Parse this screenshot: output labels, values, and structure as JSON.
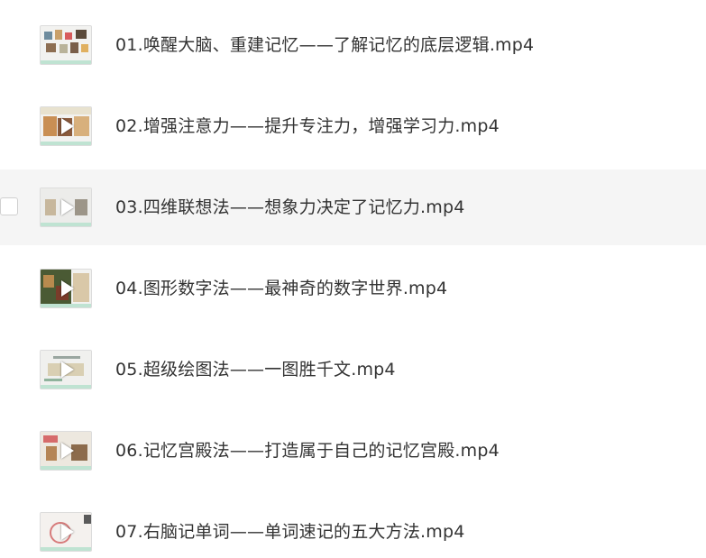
{
  "files": [
    {
      "name": "01.唤醒大脑、重建记忆——了解记忆的底层逻辑.mp4",
      "thumbnail": "video-thumbnail-icon",
      "hovered": false
    },
    {
      "name": "02.增强注意力——提升专注力，增强学习力.mp4",
      "thumbnail": "video-thumbnail-icon",
      "hovered": false
    },
    {
      "name": "03.四维联想法——想象力决定了记忆力.mp4",
      "thumbnail": "video-thumbnail-icon",
      "hovered": true
    },
    {
      "name": "04.图形数字法——最神奇的数字世界.mp4",
      "thumbnail": "video-thumbnail-icon",
      "hovered": false
    },
    {
      "name": "05.超级绘图法——一图胜千文.mp4",
      "thumbnail": "video-thumbnail-icon",
      "hovered": false
    },
    {
      "name": "06.记忆宫殿法——打造属于自己的记忆宫殿.mp4",
      "thumbnail": "video-thumbnail-icon",
      "hovered": false
    },
    {
      "name": "07.右脑记单词——单词速记的五大方法.mp4",
      "thumbnail": "video-thumbnail-icon",
      "hovered": false
    }
  ],
  "colors": {
    "text": "#333333",
    "hover_background": "#f5f5f5",
    "thumbnail_band": "#bfe3d2"
  }
}
